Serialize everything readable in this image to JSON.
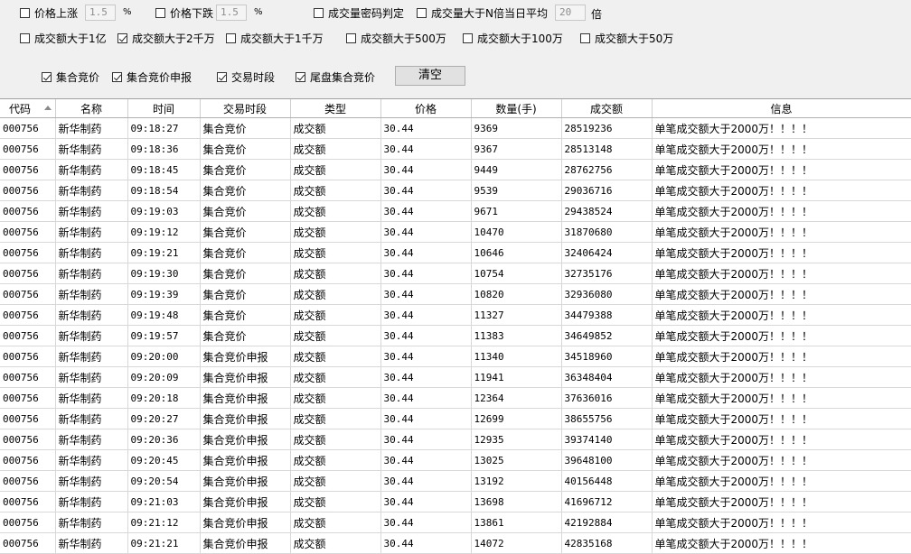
{
  "filters": {
    "price_up": {
      "label": "价格上涨",
      "checked": false,
      "value": "1.5",
      "unit": "%"
    },
    "price_down": {
      "label": "价格下跌",
      "checked": false,
      "value": "1.5",
      "unit": "%"
    },
    "vol_password": {
      "label": "成交量密码判定",
      "checked": false
    },
    "vol_multiple": {
      "label": "成交量大于N倍当日平均",
      "checked": false,
      "value": "20",
      "unit": "倍"
    },
    "amount_options": [
      {
        "label": "成交额大于1亿",
        "checked": false
      },
      {
        "label": "成交额大于2千万",
        "checked": true
      },
      {
        "label": "成交额大于1千万",
        "checked": false
      },
      {
        "label": "成交额大于500万",
        "checked": false
      },
      {
        "label": "成交额大于100万",
        "checked": false
      },
      {
        "label": "成交额大于50万",
        "checked": false
      }
    ],
    "session_options": [
      {
        "label": "集合竞价",
        "checked": true
      },
      {
        "label": "集合竞价申报",
        "checked": true
      },
      {
        "label": "交易时段",
        "checked": true
      },
      {
        "label": "尾盘集合竞价",
        "checked": true
      }
    ],
    "clear_label": "清空"
  },
  "table": {
    "columns": [
      "代码",
      "名称",
      "时间",
      "交易时段",
      "类型",
      "价格",
      "数量(手)",
      "成交额",
      "信息"
    ],
    "rows": [
      [
        "000756",
        "新华制药",
        "09:18:27",
        "集合竞价",
        "成交额",
        "30.44",
        "9369",
        "28519236",
        "单笔成交额大于2000万！！！！"
      ],
      [
        "000756",
        "新华制药",
        "09:18:36",
        "集合竞价",
        "成交额",
        "30.44",
        "9367",
        "28513148",
        "单笔成交额大于2000万！！！！"
      ],
      [
        "000756",
        "新华制药",
        "09:18:45",
        "集合竞价",
        "成交额",
        "30.44",
        "9449",
        "28762756",
        "单笔成交额大于2000万！！！！"
      ],
      [
        "000756",
        "新华制药",
        "09:18:54",
        "集合竞价",
        "成交额",
        "30.44",
        "9539",
        "29036716",
        "单笔成交额大于2000万！！！！"
      ],
      [
        "000756",
        "新华制药",
        "09:19:03",
        "集合竞价",
        "成交额",
        "30.44",
        "9671",
        "29438524",
        "单笔成交额大于2000万！！！！"
      ],
      [
        "000756",
        "新华制药",
        "09:19:12",
        "集合竞价",
        "成交额",
        "30.44",
        "10470",
        "31870680",
        "单笔成交额大于2000万！！！！"
      ],
      [
        "000756",
        "新华制药",
        "09:19:21",
        "集合竞价",
        "成交额",
        "30.44",
        "10646",
        "32406424",
        "单笔成交额大于2000万！！！！"
      ],
      [
        "000756",
        "新华制药",
        "09:19:30",
        "集合竞价",
        "成交额",
        "30.44",
        "10754",
        "32735176",
        "单笔成交额大于2000万！！！！"
      ],
      [
        "000756",
        "新华制药",
        "09:19:39",
        "集合竞价",
        "成交额",
        "30.44",
        "10820",
        "32936080",
        "单笔成交额大于2000万！！！！"
      ],
      [
        "000756",
        "新华制药",
        "09:19:48",
        "集合竞价",
        "成交额",
        "30.44",
        "11327",
        "34479388",
        "单笔成交额大于2000万！！！！"
      ],
      [
        "000756",
        "新华制药",
        "09:19:57",
        "集合竞价",
        "成交额",
        "30.44",
        "11383",
        "34649852",
        "单笔成交额大于2000万！！！！"
      ],
      [
        "000756",
        "新华制药",
        "09:20:00",
        "集合竞价申报",
        "成交额",
        "30.44",
        "11340",
        "34518960",
        "单笔成交额大于2000万！！！！"
      ],
      [
        "000756",
        "新华制药",
        "09:20:09",
        "集合竞价申报",
        "成交额",
        "30.44",
        "11941",
        "36348404",
        "单笔成交额大于2000万！！！！"
      ],
      [
        "000756",
        "新华制药",
        "09:20:18",
        "集合竞价申报",
        "成交额",
        "30.44",
        "12364",
        "37636016",
        "单笔成交额大于2000万！！！！"
      ],
      [
        "000756",
        "新华制药",
        "09:20:27",
        "集合竞价申报",
        "成交额",
        "30.44",
        "12699",
        "38655756",
        "单笔成交额大于2000万！！！！"
      ],
      [
        "000756",
        "新华制药",
        "09:20:36",
        "集合竞价申报",
        "成交额",
        "30.44",
        "12935",
        "39374140",
        "单笔成交额大于2000万！！！！"
      ],
      [
        "000756",
        "新华制药",
        "09:20:45",
        "集合竞价申报",
        "成交额",
        "30.44",
        "13025",
        "39648100",
        "单笔成交额大于2000万！！！！"
      ],
      [
        "000756",
        "新华制药",
        "09:20:54",
        "集合竞价申报",
        "成交额",
        "30.44",
        "13192",
        "40156448",
        "单笔成交额大于2000万！！！！"
      ],
      [
        "000756",
        "新华制药",
        "09:21:03",
        "集合竞价申报",
        "成交额",
        "30.44",
        "13698",
        "41696712",
        "单笔成交额大于2000万！！！！"
      ],
      [
        "000756",
        "新华制药",
        "09:21:12",
        "集合竞价申报",
        "成交额",
        "30.44",
        "13861",
        "42192884",
        "单笔成交额大于2000万！！！！"
      ],
      [
        "000756",
        "新华制药",
        "09:21:21",
        "集合竞价申报",
        "成交额",
        "30.44",
        "14072",
        "42835168",
        "单笔成交额大于2000万！！！！"
      ]
    ]
  }
}
